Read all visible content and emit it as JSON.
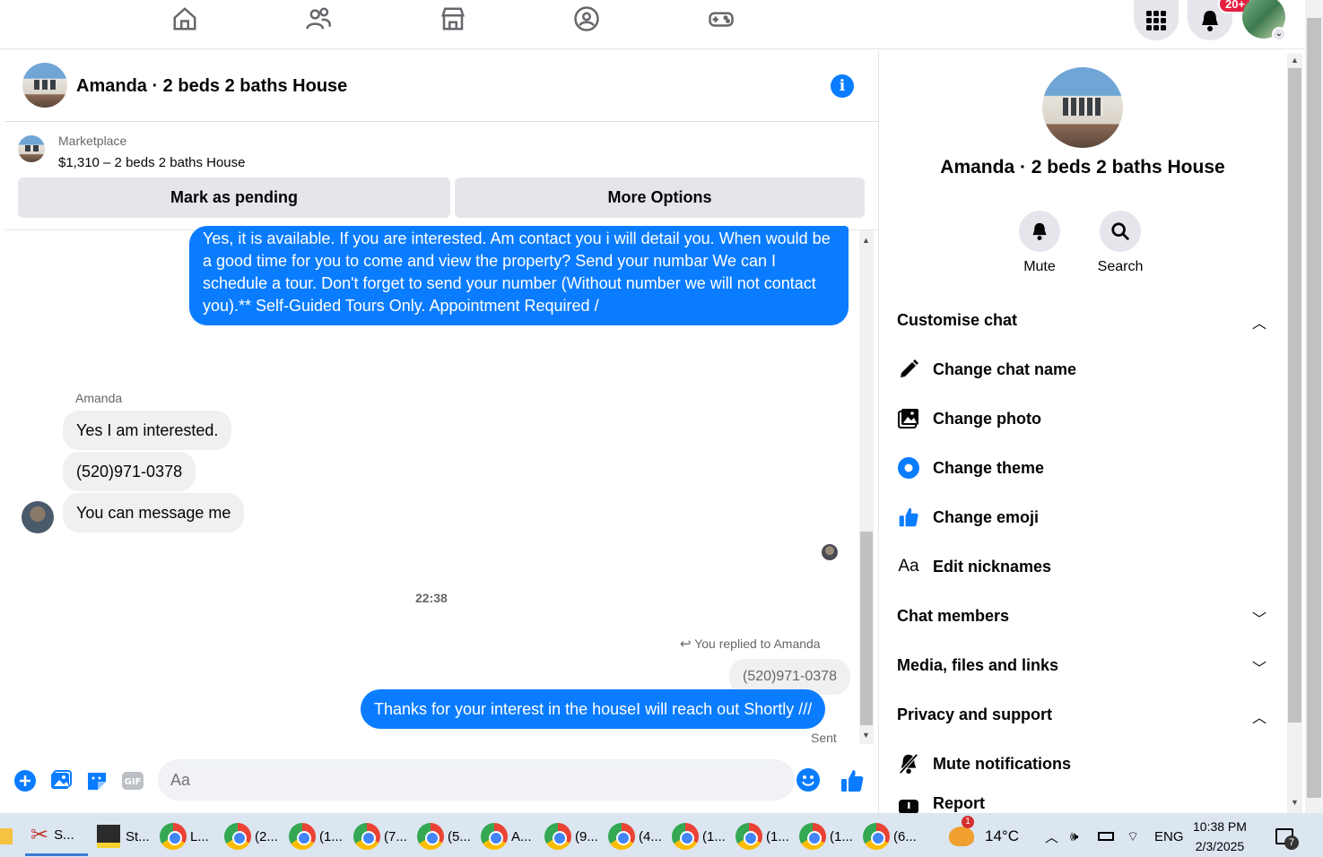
{
  "topnav": {
    "icons": [
      "home-icon",
      "friends-icon",
      "marketplace-icon",
      "groups-icon",
      "gaming-icon"
    ],
    "notification_badge": "20+"
  },
  "chat": {
    "title": "Amanda · 2 beds 2 baths House",
    "marketplace_label": "Marketplace",
    "listing": "$1,310 – 2 beds 2 baths House",
    "mark_pending": "Mark as pending",
    "more_options": "More Options",
    "messages": {
      "out_first": "Yes, it is available. If you are interested.  Am contact you i will detail you.  When would be a good time for you to come and view the property? Send your numbar We can I schedule a tour.  Don't forget to send your number (Without number we will not contact you).** Self-Guided Tours Only. Appointment Required /",
      "sender_name": "Amanda",
      "in_1": "Yes I am interested.",
      "in_2": "(520)971-0378",
      "in_3": "You can message me",
      "timestamp": "22:38",
      "replied_note": "You replied to Amanda",
      "reply_preview": "(520)971-0378",
      "out_last": "Thanks for your interest in the houseI will reach out Shortly ///",
      "status": "Sent"
    },
    "composer_placeholder": "Aa"
  },
  "panel": {
    "name": "Amanda · 2 beds 2 baths House",
    "mute": "Mute",
    "search": "Search",
    "customise_chat": "Customise chat",
    "change_chat_name": "Change chat name",
    "change_photo": "Change photo",
    "change_theme": "Change theme",
    "change_emoji": "Change emoji",
    "edit_nicknames": "Edit nicknames",
    "nickname_glyph": "Aa",
    "chat_members": "Chat members",
    "media": "Media, files and links",
    "privacy": "Privacy and support",
    "mute_notifications": "Mute notifications",
    "report": "Report"
  },
  "taskbar": {
    "items": [
      "S...",
      "St...",
      "L...",
      "(2...",
      "(1...",
      "(7...",
      "(5...",
      "A...",
      "(9...",
      "(4...",
      "(1...",
      "(1...",
      "(1...",
      "(6..."
    ],
    "weather_badge": "1",
    "temperature": "14°C",
    "language": "ENG",
    "time": "10:38 PM",
    "date": "2/3/2025",
    "notif_count": "7"
  },
  "colors": {
    "messenger_blue": "#0a7cff",
    "bubble_gray": "#f0f0f0"
  }
}
